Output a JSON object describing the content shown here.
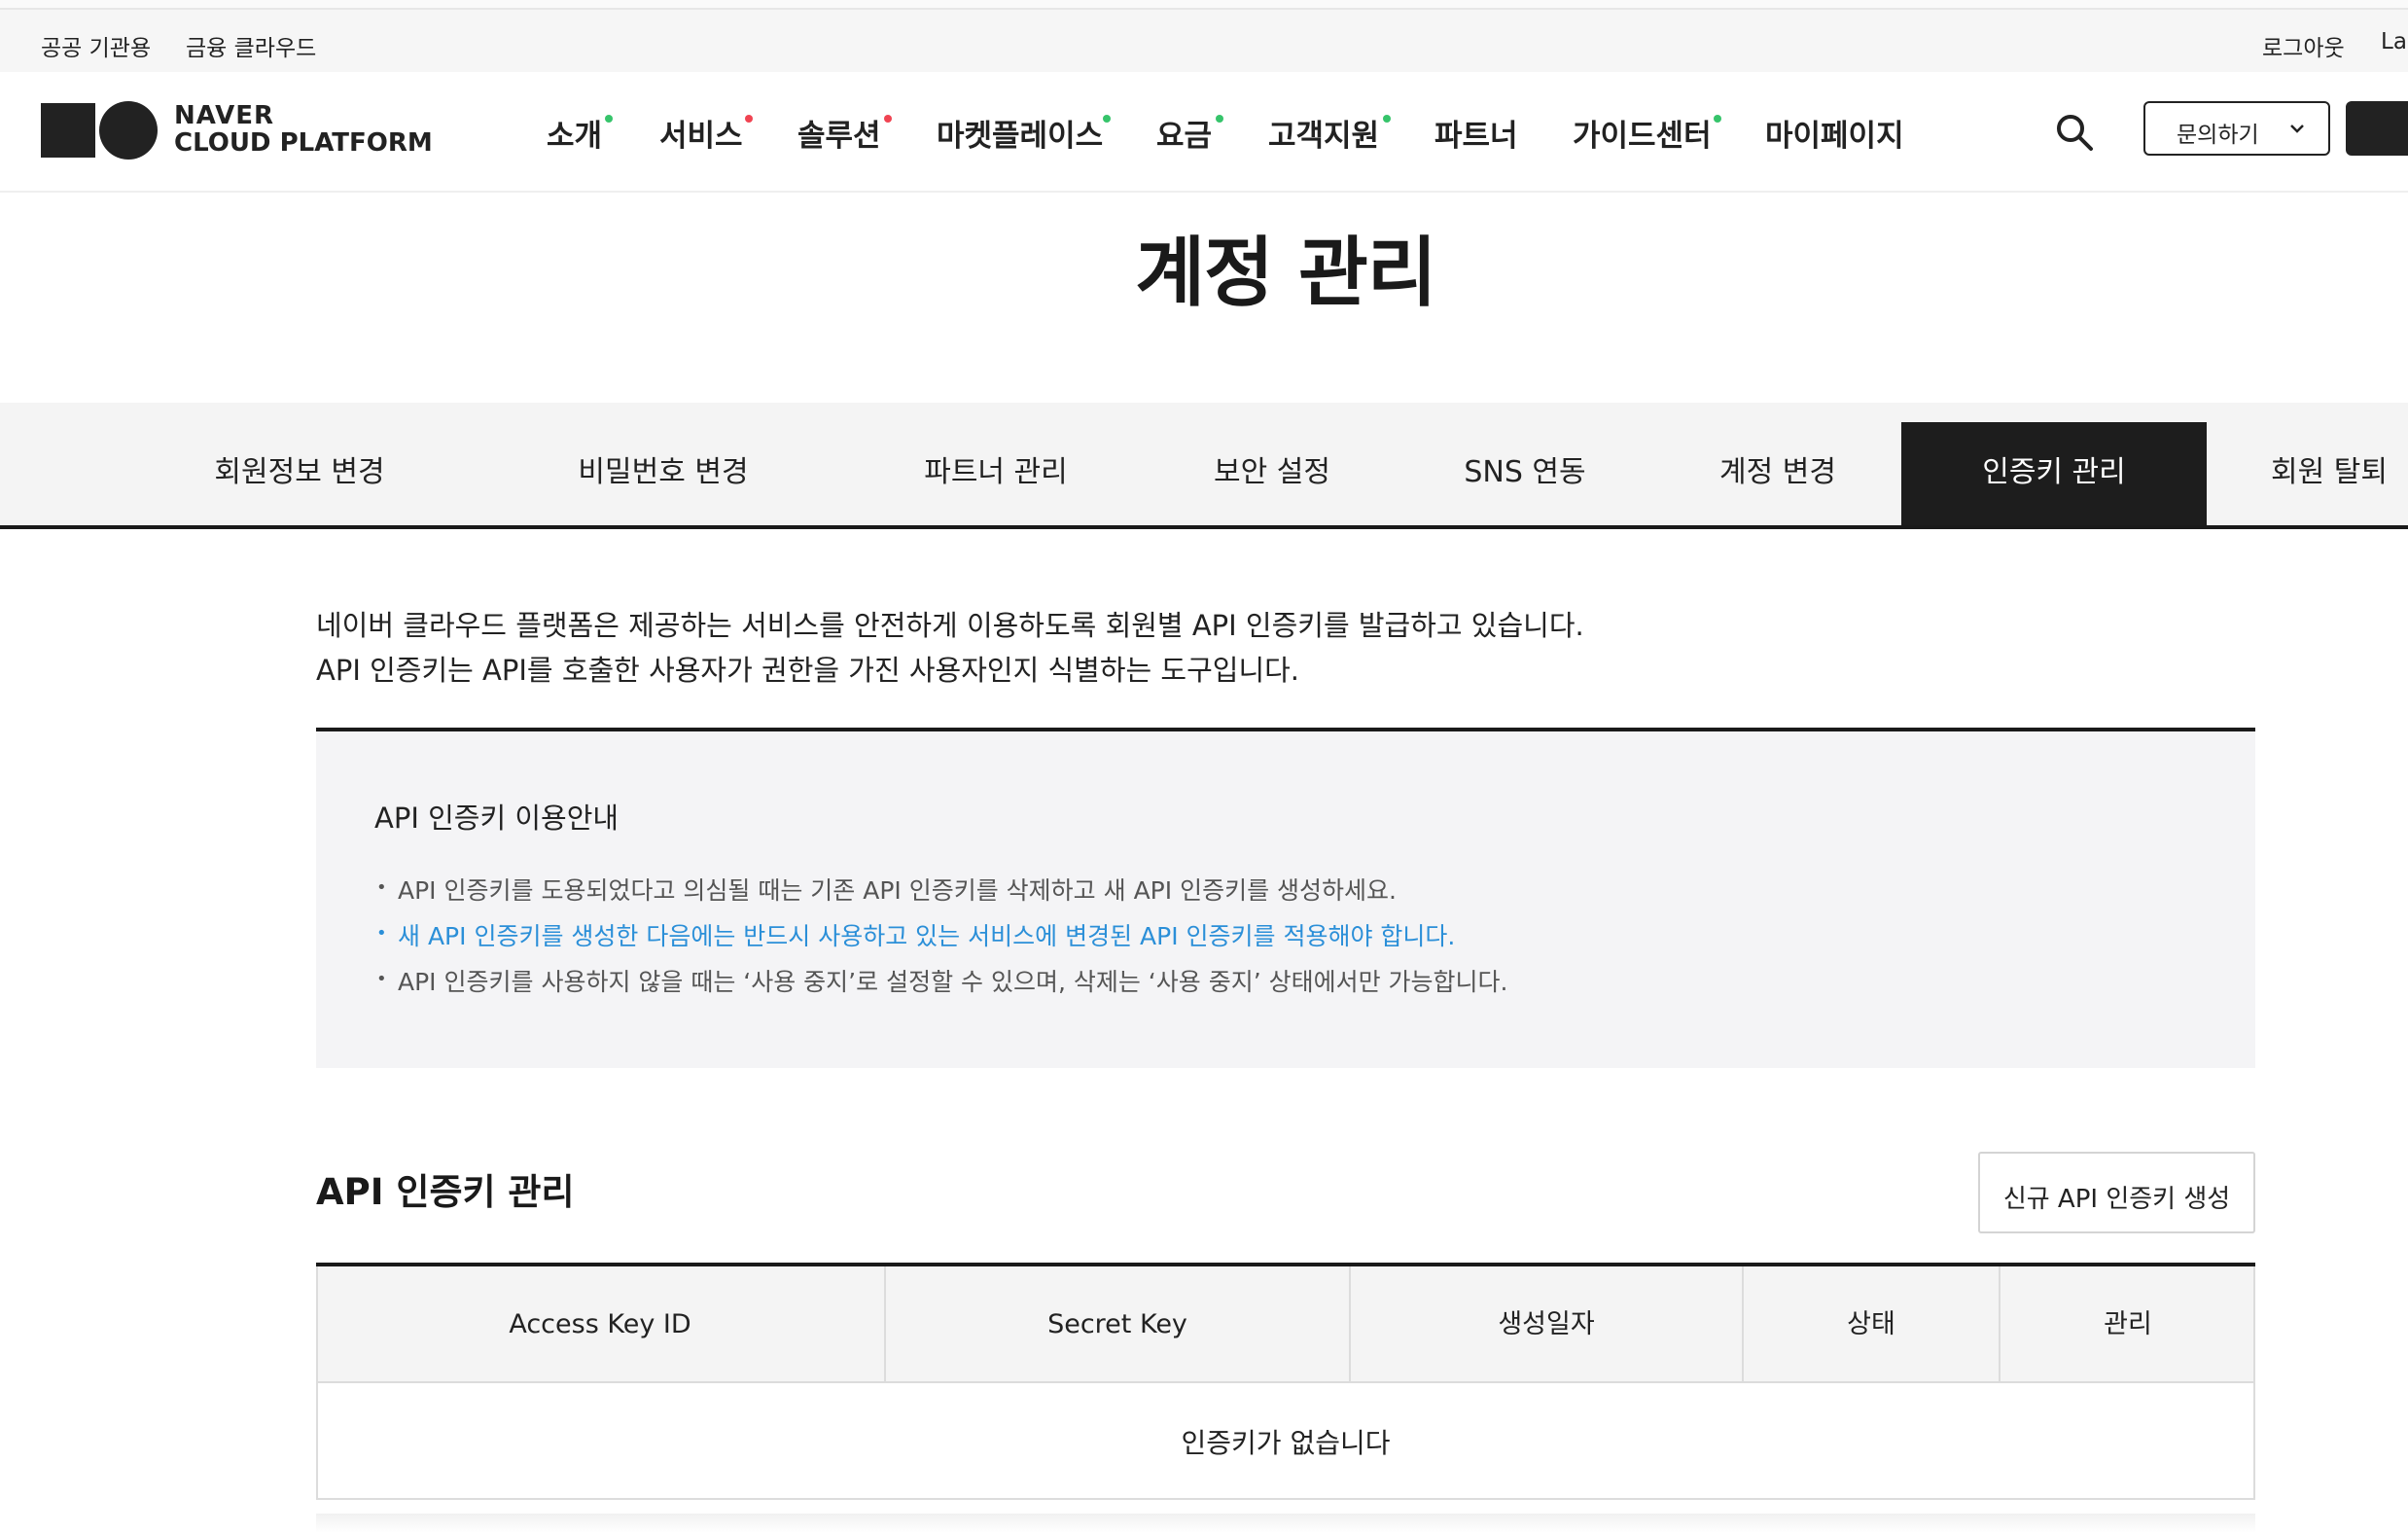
{
  "util_bar": {
    "left_links": [
      "공공 기관용",
      "금융 클라우드"
    ],
    "logout": "로그아웃",
    "language_partial": "La"
  },
  "header": {
    "logo_line1": "NAVER",
    "logo_line2": "CLOUD PLATFORM",
    "nav": [
      {
        "label": "소개",
        "dot_color": "#36c46b"
      },
      {
        "label": "서비스",
        "dot_color": "#f04452"
      },
      {
        "label": "솔루션",
        "dot_color": "#f04452"
      },
      {
        "label": "마켓플레이스",
        "dot_color": "#36c46b"
      },
      {
        "label": "요금",
        "dot_color": "#36c46b"
      },
      {
        "label": "고객지원",
        "dot_color": "#36c46b"
      },
      {
        "label": "파트너"
      },
      {
        "label": "가이드센터",
        "dot_color": "#36c46b"
      },
      {
        "label": "마이페이지"
      }
    ],
    "search_icon": "search-icon",
    "contact_label": "문의하기"
  },
  "page_title": "계정 관리",
  "tabs": [
    {
      "label": "회원정보 변경"
    },
    {
      "label": "비밀번호 변경"
    },
    {
      "label": "파트너 관리"
    },
    {
      "label": "보안 설정"
    },
    {
      "label": "SNS 연동"
    },
    {
      "label": "계정 변경"
    },
    {
      "label": "인증키 관리",
      "active": true
    },
    {
      "label": "회원 탈퇴"
    }
  ],
  "intro": {
    "line1": "네이버 클라우드 플랫폼은 제공하는 서비스를 안전하게 이용하도록 회원별 API 인증키를 발급하고 있습니다.",
    "line2": "API 인증키는 API를 호출한 사용자가 권한을 가진 사용자인지 식별하는 도구입니다."
  },
  "notice": {
    "title": "API 인증키 이용안내",
    "bullets": [
      "API 인증키를 도용되었다고 의심될 때는 기존 API 인증키를 삭제하고 새 API 인증키를 생성하세요.",
      "새 API 인증키를 생성한 다음에는 반드시 사용하고 있는 서비스에 변경된 API 인증키를 적용해야 합니다.",
      "API 인증키를 사용하지 않을 때는 ‘사용 중지’로 설정할 수 있으며, 삭제는 ‘사용 중지’ 상태에서만 가능합니다."
    ],
    "highlight_color": "#2b8fd8"
  },
  "key_section": {
    "title": "API 인증키 관리",
    "new_key_button": "신규 API 인증키 생성",
    "columns": [
      "Access Key ID",
      "Secret Key",
      "생성일자",
      "상태",
      "관리"
    ],
    "empty_text": "인증키가 없습니다"
  }
}
